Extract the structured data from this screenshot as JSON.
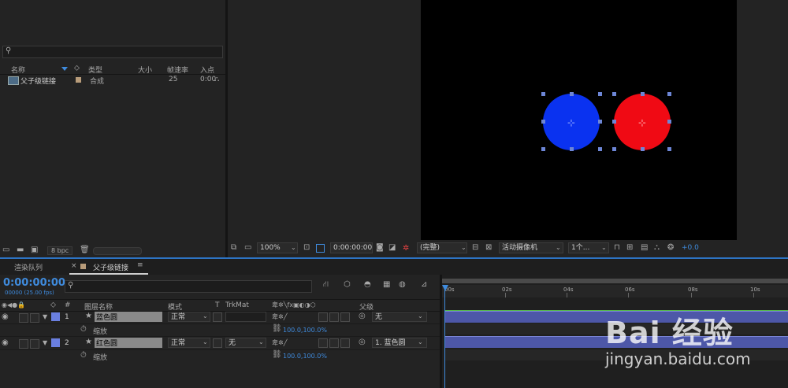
{
  "project": {
    "search_placeholder": "",
    "columns": {
      "name": "名称",
      "type": "类型",
      "size": "大小",
      "fps": "帧速率",
      "in": "入点"
    },
    "item": {
      "name": "父子级链接",
      "type": "合成",
      "fps": "25",
      "in": "0:00"
    },
    "footer_bpc": "8 bpc"
  },
  "viewer": {
    "zoom": "100%",
    "timecode": "0:00:00:00",
    "resolution": "(完整)",
    "camera": "活动摄像机",
    "views": "1个...",
    "exposure": "+0.0",
    "colors": {
      "blue_circle": "#0a32f0",
      "red_circle": "#f00a14",
      "handle": "#6d86d6"
    }
  },
  "tabs": {
    "render_queue": "渲染队列",
    "comp": "父子级链接",
    "close": "×",
    "menu": "≡"
  },
  "timeline": {
    "timecode": "0:00:00:00",
    "frame_info": "00000 (25.00 fps)",
    "columns": {
      "num": "#",
      "layer_name": "图层名称",
      "mode": "模式",
      "t": "T",
      "trkmat": "TrkMat",
      "parent": "父级"
    },
    "ruler": [
      "00s",
      "02s",
      "04s",
      "06s",
      "08s",
      "10s"
    ],
    "layers": [
      {
        "num": "1",
        "name": "蓝色圆",
        "color": "#6a7fe0",
        "mode": "正常",
        "trkmat": "",
        "parent": "无",
        "prop_label": "缩放",
        "prop_value": "100.0,100.0%"
      },
      {
        "num": "2",
        "name": "红色圆",
        "color": "#6a7fe0",
        "mode": "正常",
        "trkmat": "无",
        "parent": "1. 蓝色圆",
        "prop_label": "缩放",
        "prop_value": "100.0,100.0%"
      }
    ]
  },
  "watermark": {
    "brand": "Bai 经验",
    "url": "jingyan.baidu.com"
  }
}
